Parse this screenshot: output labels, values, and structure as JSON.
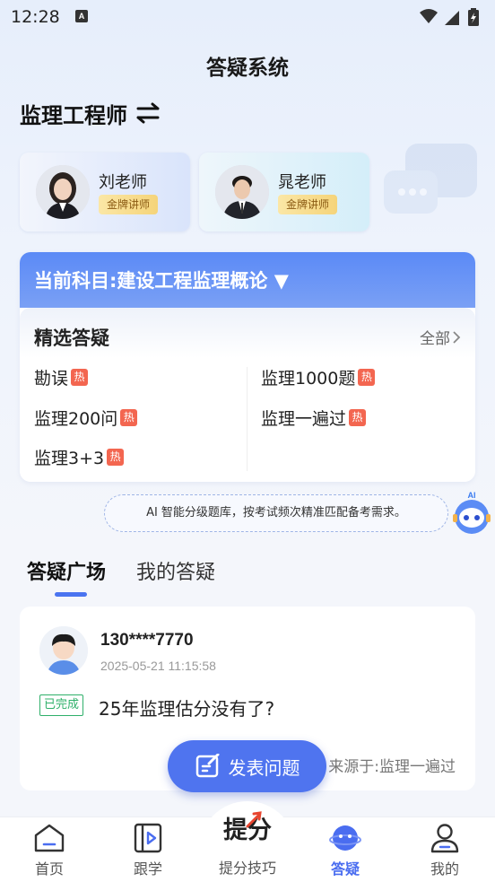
{
  "status_bar": {
    "time": "12:28",
    "notif_letter": "A"
  },
  "header": {
    "title": "答疑系统"
  },
  "exam": {
    "name": "监理工程师"
  },
  "teachers": [
    {
      "name": "刘老师",
      "badge": "金牌讲师"
    },
    {
      "name": "晁老师",
      "badge": "金牌讲师"
    }
  ],
  "subject": {
    "label": "当前科目:建设工程监理概论 ▼"
  },
  "selected": {
    "title": "精选答疑",
    "all_label": "全部",
    "hot_label": "热",
    "items": [
      "勘误",
      "监理1000题",
      "监理200问",
      "监理一遍过",
      "监理3+3"
    ]
  },
  "ai_tip": "AI 智能分级题库，按考试频次精准匹配备考需求。",
  "robot_label": "AI",
  "tabs": [
    "答疑广场",
    "我的答疑"
  ],
  "post": {
    "user": "130****7770",
    "time": "2025-05-21 11:15:58",
    "status": "已完成",
    "question": "25年监理估分没有了?",
    "source": "来源于:监理一遍过"
  },
  "fab": {
    "label": "发表问题"
  },
  "nav": {
    "items": [
      "首页",
      "跟学",
      "提分技巧",
      "答疑",
      "我的"
    ],
    "center_logo": "提分",
    "active": "答疑"
  },
  "colors": {
    "accent": "#4f74ef",
    "hot": "#f36650",
    "done": "#2fb06a",
    "badge": "#f5d47a"
  }
}
